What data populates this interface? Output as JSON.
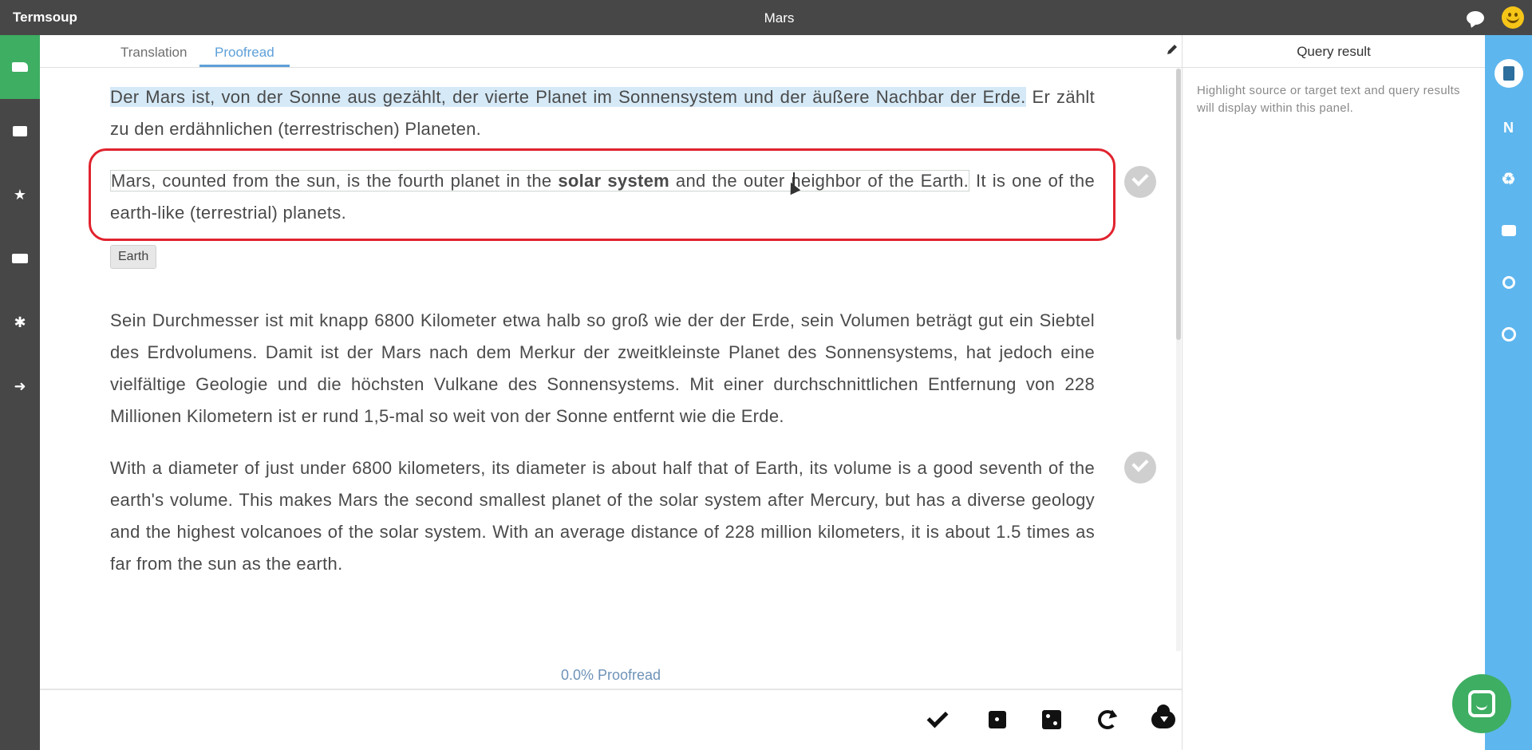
{
  "app": {
    "name": "Termsoup",
    "document_title": "Mars"
  },
  "tabs": [
    {
      "label": "Translation",
      "active": false
    },
    {
      "label": "Proofread",
      "active": true
    }
  ],
  "segments": [
    {
      "source_highlighted": "Der Mars ist, von der Sonne aus gezählt, der vierte Planet im Sonnensystem und der äußere Nachbar der Erde.",
      "source_rest": " Er zählt zu den erdähnlichen (terrestrischen) Planeten.",
      "target_part1": "Mars, counted from the sun, is the fourth planet in the ",
      "target_bold": "solar system",
      "target_part2": " and the outer neighbor of the Earth.",
      "target_rest": " It is one of the earth-like (terrestrial) planets.",
      "term_tag": "Earth"
    },
    {
      "source": "Sein Durchmesser ist mit knapp 6800 Kilometer etwa halb so groß wie der der Erde, sein Volumen beträgt gut ein Siebtel des Erdvolumens. Damit ist der Mars nach dem Merkur der zweitkleinste Planet des Sonnensystems, hat jedoch eine vielfältige Geologie und die höchsten Vulkane des Sonnensystems. Mit einer durchschnittlichen Entfernung von 228 Millionen Kilometern ist er rund 1,5-mal so weit von der Sonne entfernt wie die Erde.",
      "target": "With a diameter of just under 6800 kilometers, its diameter is about half that of Earth, its volume is a good seventh of the earth's volume. This makes Mars the second smallest planet of the solar system after Mercury, but has a diverse geology and the highest volcanoes of the solar system. With an average distance of 228 million kilometers, it is about 1.5 times as far from the sun as the earth."
    }
  ],
  "progress": {
    "text": "0.0%  Proofread",
    "value_percent": 0.0
  },
  "query_panel": {
    "title": "Query result",
    "hint": "Highlight source or target text and query results will display within this panel."
  },
  "right_toolbar": {
    "n_label": "N"
  },
  "colors": {
    "accent_green": "#3dae62",
    "accent_blue": "#5eb6ee",
    "highlight_red": "#e0232e",
    "source_highlight": "#d5e9f7"
  },
  "icons": {
    "left_nav": [
      "folder-icon",
      "film-icon",
      "star-icon",
      "store-icon",
      "gear-icon",
      "sign-out-icon"
    ],
    "right_nav": [
      "document-icon",
      "n-icon",
      "recycle-icon",
      "comment-icon",
      "search-icon",
      "history-icon"
    ],
    "bottom": [
      "checkmark-icon",
      "dice-one-icon",
      "dice-two-icon",
      "redo-icon",
      "cloud-download-icon"
    ]
  }
}
